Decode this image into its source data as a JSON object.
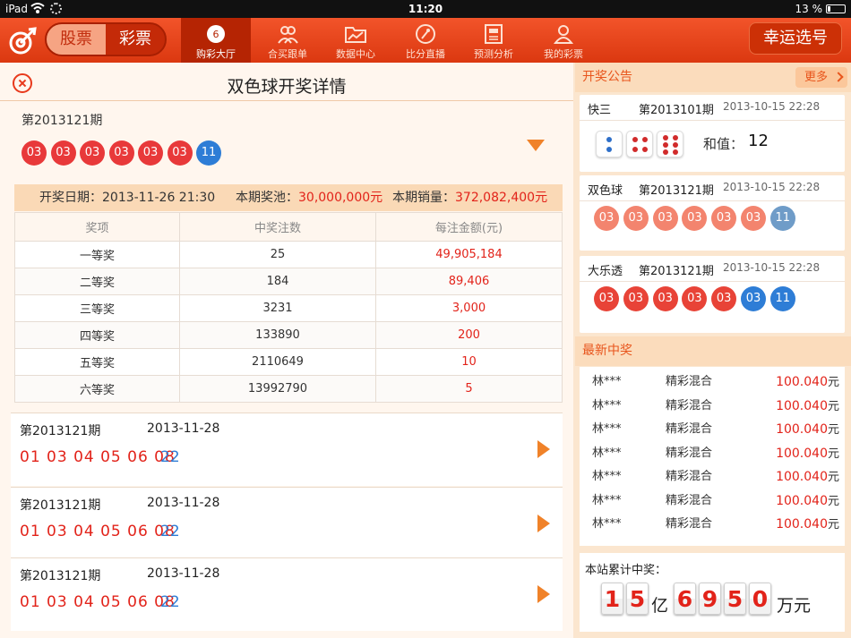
{
  "status": {
    "device": "iPad",
    "time": "11:20",
    "battery": "13 %"
  },
  "nav": {
    "seg_stock": "股票",
    "seg_lottery": "彩票",
    "items": [
      {
        "label": "购彩大厅",
        "icon": "lottery-ball-icon"
      },
      {
        "label": "合买跟单",
        "icon": "group-icon"
      },
      {
        "label": "数据中心",
        "icon": "folder-chart-icon"
      },
      {
        "label": "比分直播",
        "icon": "play-icon"
      },
      {
        "label": "预测分析",
        "icon": "document-icon"
      },
      {
        "label": "我的彩票",
        "icon": "user-icon"
      }
    ],
    "lucky": "幸运选号"
  },
  "detail": {
    "title": "双色球开奖详情",
    "issue": "第2013121期",
    "balls": [
      {
        "n": "03",
        "c": "red"
      },
      {
        "n": "03",
        "c": "red"
      },
      {
        "n": "03",
        "c": "red"
      },
      {
        "n": "03",
        "c": "red"
      },
      {
        "n": "03",
        "c": "red"
      },
      {
        "n": "03",
        "c": "red"
      },
      {
        "n": "11",
        "c": "blue"
      }
    ],
    "info": {
      "date_label": "开奖日期：",
      "date": "2013-11-26  21:30",
      "pool_label": "本期奖池：",
      "pool": "30,000,000元",
      "sales_label": "本期销量：",
      "sales": "372,082,400元"
    },
    "headers": [
      "奖项",
      "中奖注数",
      "每注金额(元)"
    ],
    "rows": [
      [
        "一等奖",
        "25",
        "49,905,184"
      ],
      [
        "二等奖",
        "184",
        "89,406"
      ],
      [
        "三等奖",
        "3231",
        "3,000"
      ],
      [
        "四等奖",
        "133890",
        "200"
      ],
      [
        "五等奖",
        "2110649",
        "10"
      ],
      [
        "六等奖",
        "13992790",
        "5"
      ]
    ]
  },
  "history": [
    {
      "issue": "第2013121期",
      "date": "2013-11-28",
      "red": "01 03 04 05 06 08",
      "blue": "22"
    },
    {
      "issue": "第2013121期",
      "date": "2013-11-28",
      "red": "01 03 04 05 06 08",
      "blue": "22"
    },
    {
      "issue": "第2013121期",
      "date": "2013-11-28",
      "red": "01 03 04 05 06 08",
      "blue": "22"
    }
  ],
  "announce": {
    "title": "开奖公告",
    "more": "更多",
    "k3": {
      "name": "快三",
      "issue": "第2013101期",
      "date": "2013-10-15  22:28",
      "sum_label": "和值：",
      "sum": "12"
    },
    "ssq": {
      "name": "双色球",
      "issue": "第2013121期",
      "date": "2013-10-15  22:28",
      "balls": [
        {
          "n": "03",
          "c": "light"
        },
        {
          "n": "03",
          "c": "light"
        },
        {
          "n": "03",
          "c": "light"
        },
        {
          "n": "03",
          "c": "light"
        },
        {
          "n": "03",
          "c": "light"
        },
        {
          "n": "03",
          "c": "light"
        },
        {
          "n": "11",
          "c": "steel"
        }
      ]
    },
    "dlt": {
      "name": "大乐透",
      "issue": "第2013121期",
      "date": "2013-10-15  22:28",
      "balls": [
        {
          "n": "03",
          "c": "red"
        },
        {
          "n": "03",
          "c": "red"
        },
        {
          "n": "03",
          "c": "red"
        },
        {
          "n": "03",
          "c": "red"
        },
        {
          "n": "03",
          "c": "red"
        },
        {
          "n": "03",
          "c": "blue"
        },
        {
          "n": "11",
          "c": "blue"
        }
      ]
    }
  },
  "latest": {
    "title": "最新中奖",
    "rows": [
      {
        "name": "林***",
        "game": "精彩混合",
        "amount": "100.040",
        "unit": "元"
      },
      {
        "name": "林***",
        "game": "精彩混合",
        "amount": "100.040",
        "unit": "元"
      },
      {
        "name": "林***",
        "game": "精彩混合",
        "amount": "100.040",
        "unit": "元"
      },
      {
        "name": "林***",
        "game": "精彩混合",
        "amount": "100.040",
        "unit": "元"
      },
      {
        "name": "林***",
        "game": "精彩混合",
        "amount": "100.040",
        "unit": "元"
      },
      {
        "name": "林***",
        "game": "精彩混合",
        "amount": "100.040",
        "unit": "元"
      },
      {
        "name": "林***",
        "game": "精彩混合",
        "amount": "100.040",
        "unit": "元"
      }
    ]
  },
  "total": {
    "label": "本站累计中奖：",
    "yi_digits": [
      "1",
      "5"
    ],
    "yi_unit": "亿",
    "wan_digits": [
      "6",
      "9",
      "5",
      "0"
    ],
    "wan_unit": "万元"
  }
}
